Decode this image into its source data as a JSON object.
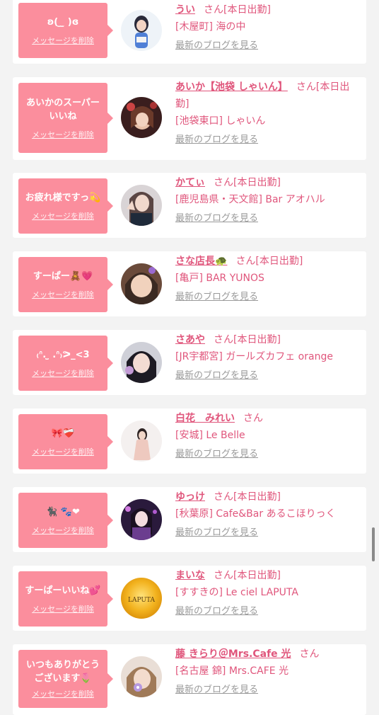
{
  "delete_label": "メッセージを削除",
  "blog_label": "最新のブログを見る",
  "colors": {
    "accent": "#fb8e9d",
    "link": "#e0567c",
    "background": "#f3f3f3"
  },
  "cards": [
    {
      "message": "ʚ(  ̫ ̫ )ɞ",
      "name": "うい",
      "suffix": "さん[本日出勤]",
      "shop": "[木屋町] 海の中"
    },
    {
      "message": "あいかのスーパー\nいいね",
      "name": "あいか【池袋 しゃいん】",
      "suffix": "さん[本日出勤]",
      "shop": "[池袋東口] しゃいん"
    },
    {
      "message": "お疲れ様ですっ💫",
      "name": "かてぃ",
      "suffix": "さん[本日出勤]",
      "shop": "[鹿児島県・天文館] Bar アオハル"
    },
    {
      "message": "すーぱー🧸💗",
      "name": "さな店長🐢",
      "suffix": "さん[本日出勤]",
      "shop": "[亀戸] BAR YUNOS"
    },
    {
      "message": "₍ᐢ. ̫ .ᐢ₎ᕗ_<3",
      "name": "さあや",
      "suffix": "さん[本日出勤]",
      "shop": "[JR宇都宮] ガールズカフェ orange"
    },
    {
      "message": "🎀❤️‍🩹",
      "name": "白花　みれい",
      "suffix": "さん",
      "shop": "[安城] Le Belle"
    },
    {
      "message": "🐈‍⬛ 🐾❤",
      "name": "ゆっけ",
      "suffix": "さん[本日出勤]",
      "shop": "[秋葉原] Cafe&Bar あるこほりっく"
    },
    {
      "message": "すーぱーいいね💕",
      "name": "まいな",
      "suffix": "さん[本日出勤]",
      "shop": "[すすきの] Le ciel LAPUTA"
    },
    {
      "message": "いつもありがとう\nございます🌷",
      "name": "藤 きらり＠Mrs.Cafe 光",
      "suffix": "さん",
      "shop": "[名古屋 錦] Mrs.CAFE 光"
    }
  ],
  "avatar_texts": {
    "laputa": "LAPUTA"
  }
}
